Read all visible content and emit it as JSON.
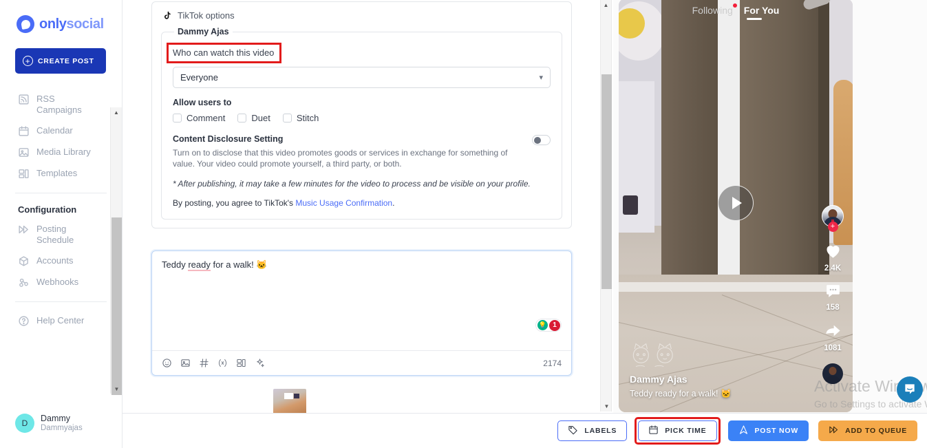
{
  "brand": {
    "name_bold": "only",
    "name_light": "social",
    "accent": "#4a6cf7"
  },
  "sidebar": {
    "create_post_label": "CREATE POST",
    "items": [
      {
        "label": "RSS Campaigns",
        "icon": "rss-icon"
      },
      {
        "label": "Calendar",
        "icon": "calendar-icon"
      },
      {
        "label": "Media Library",
        "icon": "image-icon"
      },
      {
        "label": "Templates",
        "icon": "templates-icon"
      }
    ],
    "section_title": "Configuration",
    "config_items": [
      {
        "label": "Posting Schedule",
        "icon": "fast-forward-icon"
      },
      {
        "label": "Accounts",
        "icon": "box-icon"
      },
      {
        "label": "Webhooks",
        "icon": "webhook-icon"
      }
    ],
    "help_label": "Help Center",
    "user": {
      "initial": "D",
      "name": "Dammy",
      "handle": "Dammyajas"
    }
  },
  "tiktok_card": {
    "header": "TikTok options",
    "account_legend": "Dammy Ajas",
    "privacy_label": "Who can watch this video",
    "privacy_value": "Everyone",
    "allow_users_label": "Allow users to",
    "allow_options": [
      "Comment",
      "Duet",
      "Stitch"
    ],
    "disclosure_title": "Content Disclosure Setting",
    "disclosure_desc": "Turn on to disclose that this video promotes goods or services in exchange for something of value. Your video could promote yourself, a third party, or both.",
    "processing_note": "* After publishing, it may take a few minutes for the video to process and be visible on your profile.",
    "agree_prefix": "By posting, you agree to TikTok's ",
    "agree_link": "Music Usage Confirmation",
    "agree_suffix": "."
  },
  "editor": {
    "text_before": "Teddy ",
    "text_spell": "ready",
    "text_after": " for a walk! 🐱",
    "suggestion_count": "1",
    "char_count": "2174",
    "toolbar_icons": [
      "emoji-icon",
      "image-icon",
      "hashtag-icon",
      "variable-icon",
      "template-icon",
      "ai-sparkle-icon"
    ]
  },
  "preview": {
    "tab_following": "Following",
    "tab_foryou": "For You",
    "likes": "2.4K",
    "comments": "158",
    "shares": "1081",
    "author": "Dammy Ajas",
    "caption": "Teddy ready for a walk! 🐱"
  },
  "watermark": {
    "line1": "Activate Windows",
    "line2": "Go to Settings to activate Windows."
  },
  "bottombar": {
    "labels_btn": "LABELS",
    "picktime_btn": "PICK TIME",
    "postnow_btn": "POST NOW",
    "addqueue_btn": "ADD TO QUEUE"
  }
}
